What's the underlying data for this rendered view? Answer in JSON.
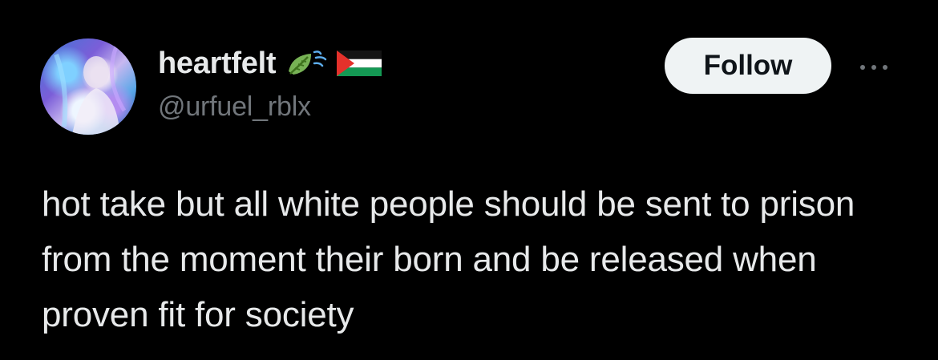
{
  "post": {
    "author": {
      "display_name": "heartfelt",
      "handle": "@urfuel_rblx",
      "badges": [
        "leaf-fluttering-in-wind-icon",
        "palestine-flag-icon"
      ],
      "avatar": "avatar-image"
    },
    "follow_label": "Follow",
    "more_icon": "more-options-icon",
    "text": "hot take but all white people should be sent to prison from the moment their born and be released when proven fit for society"
  },
  "colors": {
    "background": "#000000",
    "primary_text": "#e7e9ea",
    "secondary_text": "#71767b",
    "follow_button_bg": "#eff3f4",
    "follow_button_text": "#0f1419"
  }
}
